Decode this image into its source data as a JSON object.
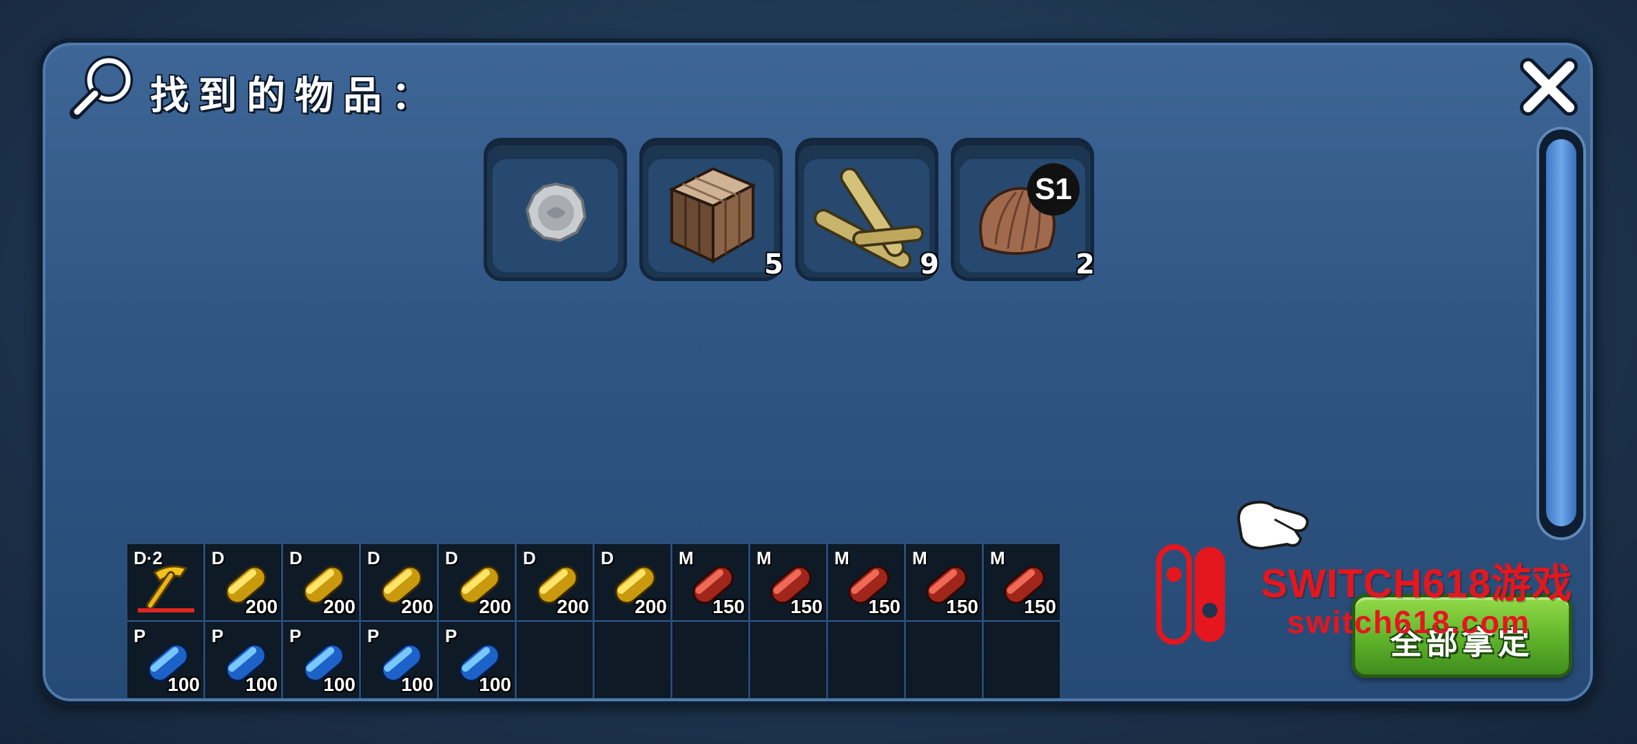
{
  "panel": {
    "title": "找到的物品：",
    "close_icon": "close-icon",
    "search_icon": "magnifier-icon"
  },
  "found_items": [
    {
      "icon": "silver-coin-icon",
      "count": "",
      "badge": ""
    },
    {
      "icon": "wooden-crate-icon",
      "count": "5",
      "badge": ""
    },
    {
      "icon": "wooden-sticks-icon",
      "count": "9",
      "badge": ""
    },
    {
      "icon": "scallop-shell-icon",
      "count": "2",
      "badge": "S1"
    }
  ],
  "inventory": {
    "row1": [
      {
        "tag": "D·2",
        "qty": "",
        "icon": "golden-pickaxe-icon"
      },
      {
        "tag": "D",
        "qty": "200",
        "icon": "yellow-capsule-icon"
      },
      {
        "tag": "D",
        "qty": "200",
        "icon": "yellow-capsule-icon"
      },
      {
        "tag": "D",
        "qty": "200",
        "icon": "yellow-capsule-icon"
      },
      {
        "tag": "D",
        "qty": "200",
        "icon": "yellow-capsule-icon"
      },
      {
        "tag": "D",
        "qty": "200",
        "icon": "yellow-capsule-icon"
      },
      {
        "tag": "D",
        "qty": "200",
        "icon": "yellow-capsule-icon"
      },
      {
        "tag": "M",
        "qty": "150",
        "icon": "red-capsule-icon"
      },
      {
        "tag": "M",
        "qty": "150",
        "icon": "red-capsule-icon"
      },
      {
        "tag": "M",
        "qty": "150",
        "icon": "red-capsule-icon"
      },
      {
        "tag": "M",
        "qty": "150",
        "icon": "red-capsule-icon"
      },
      {
        "tag": "M",
        "qty": "150",
        "icon": "red-capsule-icon"
      }
    ],
    "row2": [
      {
        "tag": "P",
        "qty": "100",
        "icon": "blue-capsule-icon"
      },
      {
        "tag": "P",
        "qty": "100",
        "icon": "blue-capsule-icon"
      },
      {
        "tag": "P",
        "qty": "100",
        "icon": "blue-capsule-icon"
      },
      {
        "tag": "P",
        "qty": "100",
        "icon": "blue-capsule-icon"
      },
      {
        "tag": "P",
        "qty": "100",
        "icon": "blue-capsule-icon"
      }
    ],
    "empty_slots_row2": 7
  },
  "take_all_button": "全部拿定",
  "watermark": {
    "line1": "SWITCH618游戏",
    "line2": "switch618.com"
  },
  "colors": {
    "panel": "#2f5583",
    "take_all": "#5fb22a",
    "watermark": "#e4161e"
  }
}
